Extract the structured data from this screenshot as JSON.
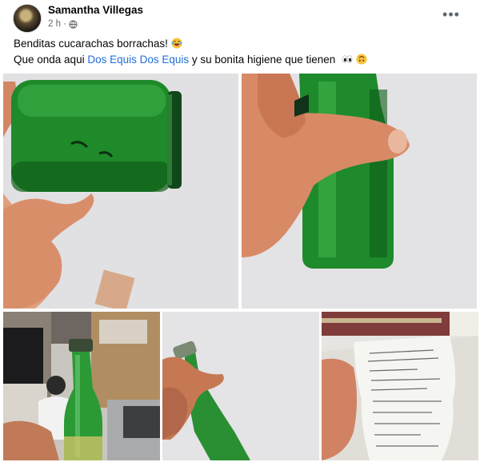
{
  "post": {
    "author": "Samantha Villegas",
    "time": "2 h",
    "separator": "·",
    "privacy_icon": "globe-icon",
    "more_options_icon": "more-options-icon",
    "more_label": "•••",
    "text": {
      "line1": "Benditas cucarachas borrachas!",
      "line1_emoji": "laughing-crying-emoji",
      "line2_start": "Que onda aqui ",
      "mention1": "Dos Equis",
      "mention_space": " ",
      "mention2": "Dos Equis",
      "line2_end": " y su bonita higiene que tienen ",
      "line2_emojis": [
        "eyes-emoji",
        "upside-down-face-emoji"
      ]
    },
    "link_color": "#216fdb",
    "photos": [
      {
        "subject": "green-beer-bottle-horizontal-with-insects"
      },
      {
        "subject": "hand-holding-green-beer-bottle"
      },
      {
        "subject": "beer-bottle-at-restaurant"
      },
      {
        "subject": "hand-holding-beer-bottle-neck"
      },
      {
        "subject": "hand-holding-receipt"
      }
    ]
  }
}
